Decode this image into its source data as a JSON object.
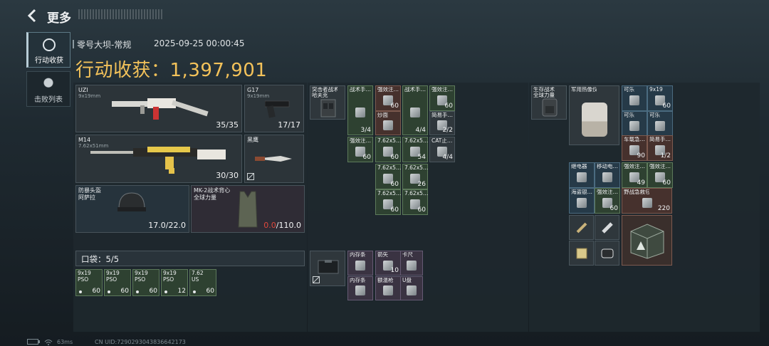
{
  "header": {
    "title": "更多"
  },
  "tabs": [
    {
      "label": "行动收获"
    },
    {
      "label": "击败列表"
    }
  ],
  "info": {
    "map": "零号大坝-常规",
    "datetime": "2025-09-25 00:00:45"
  },
  "harvest": {
    "label": "行动收获：",
    "value": "1,397,901"
  },
  "loadout": {
    "uzi": {
      "name": "UZI",
      "caliber": "9x19mm",
      "count": "35/35"
    },
    "g17": {
      "name": "G17",
      "caliber": "9x19mm",
      "count": "17/17"
    },
    "m14": {
      "name": "M14",
      "caliber": "7.62x51mm",
      "count": "30/30"
    },
    "knife": {
      "name": "黑鹰"
    },
    "helmet": {
      "name": "防暴头盔",
      "sub": "阿萨拉",
      "count": "17.0/22.0"
    },
    "vest": {
      "name": "MK-2战术背心",
      "sub": "全球力量",
      "count_red": "0.0",
      "count_rest": "/110.0"
    }
  },
  "pocket": {
    "label": "口袋：5/5",
    "items": [
      {
        "name": "9x19",
        "sub": "PSO",
        "qty": "60"
      },
      {
        "name": "9x19",
        "sub": "PSO",
        "qty": "60"
      },
      {
        "name": "9x19",
        "sub": "PSO",
        "qty": "60"
      },
      {
        "name": "9x19",
        "sub": "PSO",
        "qty": "12"
      },
      {
        "name": "7.62",
        "sub": "US",
        "qty": "60"
      }
    ]
  },
  "rig": {
    "name": "突击者战术",
    "sub": "哈夫克",
    "items": [
      {
        "name": "战术手…",
        "qty": "3/4"
      },
      {
        "name": "强效注…",
        "qty": "60"
      },
      {
        "name": "炒面",
        "qty": ""
      },
      {
        "name": "战术手…",
        "qty": "4/4"
      },
      {
        "name": "强效注…",
        "qty": "60"
      },
      {
        "name": "简易手…",
        "qty": "2/2"
      },
      {
        "name": "强效注…",
        "qty": "60"
      },
      {
        "name": "7.62x5…",
        "qty": "60"
      },
      {
        "name": "7.62x5…",
        "qty": "54"
      },
      {
        "name": "CAT止…",
        "qty": "4/4"
      },
      {
        "name": "7.62x5…",
        "qty": "60"
      },
      {
        "name": "7.62x5…",
        "qty": "26"
      },
      {
        "name": "7.62x5…",
        "qty": "60"
      },
      {
        "name": "7.62x5…",
        "qty": "60"
      }
    ]
  },
  "case": {
    "items": [
      {
        "name": "内存条",
        "qty": ""
      },
      {
        "name": "箭矢",
        "qty": "10"
      },
      {
        "name": "卡尺",
        "qty": ""
      },
      {
        "name": "内存条",
        "qty": ""
      },
      {
        "name": "额温枪",
        "qty": ""
      },
      {
        "name": "U盘",
        "qty": ""
      }
    ]
  },
  "backpack": {
    "name": "生存战术",
    "sub": "全球力量",
    "items": [
      {
        "name": "军用热像仪",
        "qty": ""
      },
      {
        "name": "可乐",
        "qty": ""
      },
      {
        "name": "9x19",
        "qty": "60"
      },
      {
        "name": "可乐",
        "qty": ""
      },
      {
        "name": "可乐",
        "qty": ""
      },
      {
        "name": "车载急…",
        "qty": "90"
      },
      {
        "name": "简易手…",
        "qty": "1/2"
      },
      {
        "name": "继电器",
        "qty": ""
      },
      {
        "name": "移动电…",
        "qty": ""
      },
      {
        "name": "强效注…",
        "qty": "49"
      },
      {
        "name": "强效注…",
        "qty": "60"
      },
      {
        "name": "海盗银…",
        "qty": ""
      },
      {
        "name": "强效注…",
        "qty": "60"
      },
      {
        "name": "野战急救包",
        "qty": "220"
      }
    ]
  },
  "footer": {
    "ping": "63ms",
    "uid": "CN UID:7290293043836642173"
  }
}
